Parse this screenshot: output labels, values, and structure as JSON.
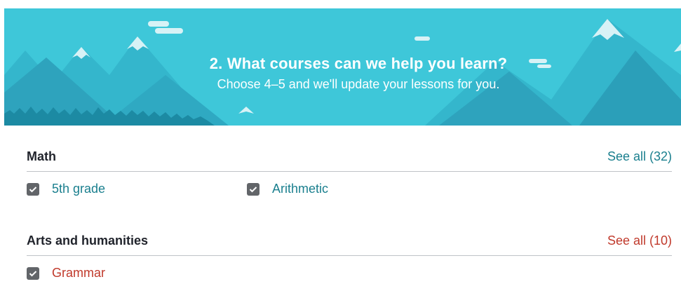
{
  "banner": {
    "title": "2. What courses can we help you learn?",
    "subtitle": "Choose 4–5 and we'll update your lessons for you."
  },
  "sections": [
    {
      "title": "Math",
      "see_all": "See all (32)",
      "accent_color": "#1a7f8e",
      "items": [
        {
          "label": "5th grade",
          "checked": true
        },
        {
          "label": "Arithmetic",
          "checked": true
        }
      ]
    },
    {
      "title": "Arts and humanities",
      "see_all": "See all (10)",
      "accent_color": "#c0392b",
      "items": [
        {
          "label": "Grammar",
          "checked": true
        }
      ]
    }
  ],
  "icons": {
    "checkbox": "checkmark-icon"
  },
  "colors": {
    "banner_bg": "#3ec7d9",
    "math_accent": "#1a7f8e",
    "arts_accent": "#c0392b",
    "checkbox_fill": "#626569"
  }
}
